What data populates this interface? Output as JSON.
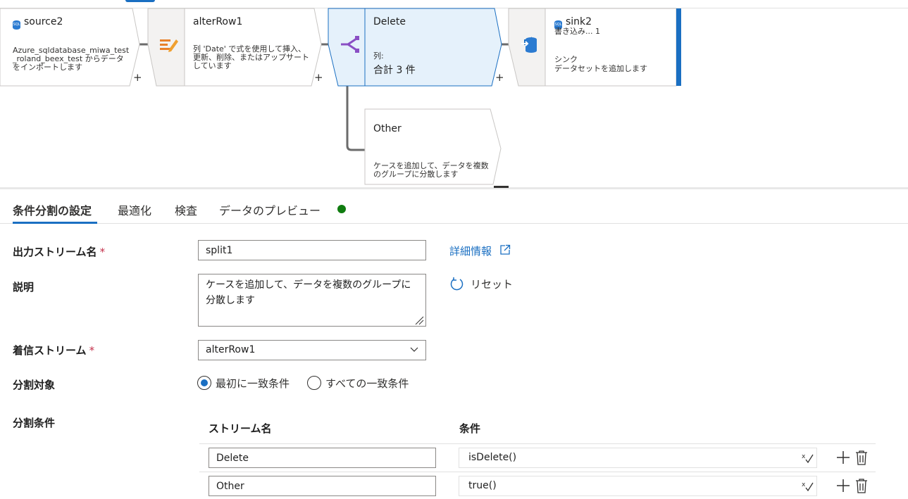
{
  "flow": {
    "source": {
      "title": "source2",
      "desc": "Azure_sqldatabase_miwa_test_roland_beex_test からデータをインポートします",
      "add": "+"
    },
    "alter": {
      "title": "alterRow1",
      "desc": "列 'Date' で式を使用して挿入、更新、削除、またはアップサートしています",
      "add": "+"
    },
    "delete": {
      "title": "Delete",
      "col_label": "列:",
      "total": "合計 3 件",
      "add": "+"
    },
    "sink": {
      "title": "sink2",
      "sub": "書き込み... 1",
      "kind": "シンク",
      "desc": "データセットを追加します"
    },
    "other": {
      "title": "Other",
      "desc": "ケースを追加して、データを複数のグループに分散します"
    }
  },
  "tabs": [
    "条件分割の設定",
    "最適化",
    "検査",
    "データのプレビュー"
  ],
  "status_color": "#107c10",
  "form": {
    "output_label": "出力ストリーム名",
    "required_mark": "*",
    "output_value": "split1",
    "details_link": "詳細情報",
    "desc_label": "説明",
    "desc_value": "ケースを追加して、データを複数のグループに分散します",
    "reset_label": "リセット",
    "incoming_label": "着信ストリーム",
    "incoming_value": "alterRow1",
    "split_on_label": "分割対象",
    "split_on_options": [
      "最初に一致条件",
      "すべての一致条件"
    ],
    "split_on_selected": 0,
    "conditions_label": "分割条件",
    "col_stream": "ストリーム名",
    "col_condition": "条件",
    "rows": [
      {
        "stream": "Delete",
        "condition": "isDelete()"
      },
      {
        "stream": "Other",
        "condition": "true()"
      }
    ]
  },
  "colors": {
    "accent": "#1a6fc2",
    "required": "#c4314b",
    "node_selected_fill": "#e5f1fb"
  }
}
